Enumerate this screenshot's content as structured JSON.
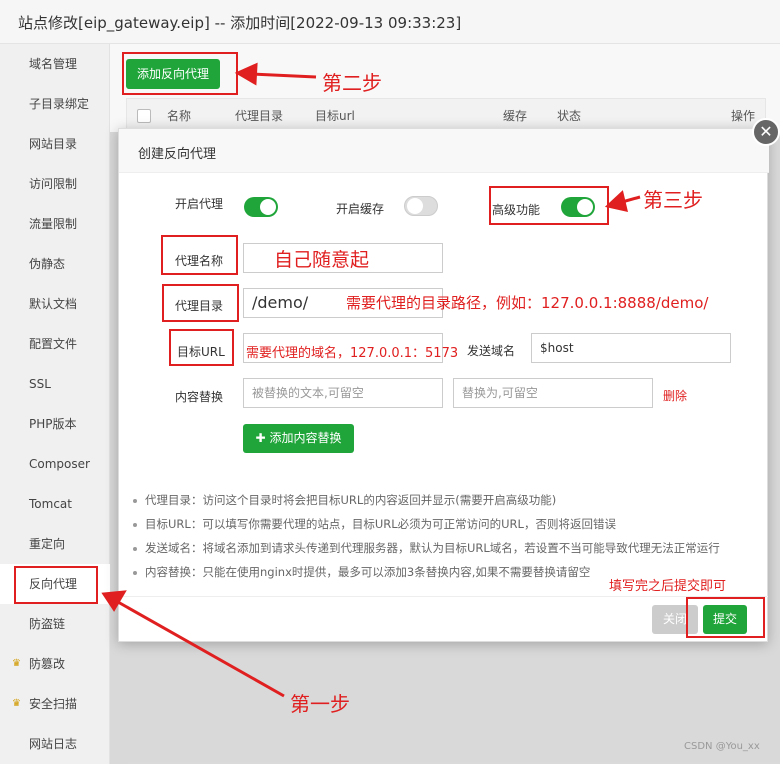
{
  "window": {
    "title": "站点修改[eip_gateway.eip] -- 添加时间[2022-09-13 09:33:23]"
  },
  "sidebar": {
    "items": [
      {
        "label": "域名管理"
      },
      {
        "label": "子目录绑定"
      },
      {
        "label": "网站目录"
      },
      {
        "label": "访问限制"
      },
      {
        "label": "流量限制"
      },
      {
        "label": "伪静态"
      },
      {
        "label": "默认文档"
      },
      {
        "label": "配置文件"
      },
      {
        "label": "SSL"
      },
      {
        "label": "PHP版本"
      },
      {
        "label": "Composer"
      },
      {
        "label": "Tomcat"
      },
      {
        "label": "重定向"
      },
      {
        "label": "反向代理"
      },
      {
        "label": "防盗链"
      },
      {
        "label": "防篡改",
        "icon": "crown-icon"
      },
      {
        "label": "安全扫描",
        "icon": "crown-icon"
      },
      {
        "label": "网站日志"
      }
    ]
  },
  "main": {
    "add_proxy_button": "添加反向代理",
    "table_headers": [
      "名称",
      "代理目录",
      "目标url",
      "缓存",
      "状态",
      "操作"
    ]
  },
  "dialog": {
    "title": "创建反向代理",
    "enable_proxy_label": "开启代理",
    "enable_cache_label": "开启缓存",
    "advanced_label": "高级功能",
    "proxy_name_label": "代理名称",
    "proxy_dir_label": "代理目录",
    "proxy_dir_value": "/demo/",
    "target_url_label": "目标URL",
    "send_domain_label": "发送域名",
    "send_domain_value": "$host",
    "content_replace_label": "内容替换",
    "replace_from_placeholder": "被替换的文本,可留空",
    "replace_to_placeholder": "替换为,可留空",
    "delete_label": "删除",
    "add_replace_button": "添加内容替换",
    "tips": [
      "代理目录：访问这个目录时将会把目标URL的内容返回并显示(需要开启高级功能)",
      "目标URL：可以填写你需要代理的站点，目标URL必须为可正常访问的URL，否则将返回错误",
      "发送域名：将域名添加到请求头传递到代理服务器，默认为目标URL域名，若设置不当可能导致代理无法正常运行",
      "内容替换：只能在使用nginx时提供，最多可以添加3条替换内容,如果不需要替换请留空"
    ],
    "close_button": "关闭",
    "submit_button": "提交"
  },
  "annotations": {
    "step1": "第一步",
    "step2": "第二步",
    "step3": "第三步",
    "name_hint": "自己随意起",
    "dir_hint": "需要代理的目录路径，例如：127.0.0.1:8888/demo/",
    "url_hint": "需要代理的域名，127.0.0.1：5173",
    "submit_hint": "填写完之后提交即可"
  },
  "watermark": "CSDN @You_xx",
  "colors": {
    "accent": "#20a53a",
    "annotation": "#e02020"
  }
}
